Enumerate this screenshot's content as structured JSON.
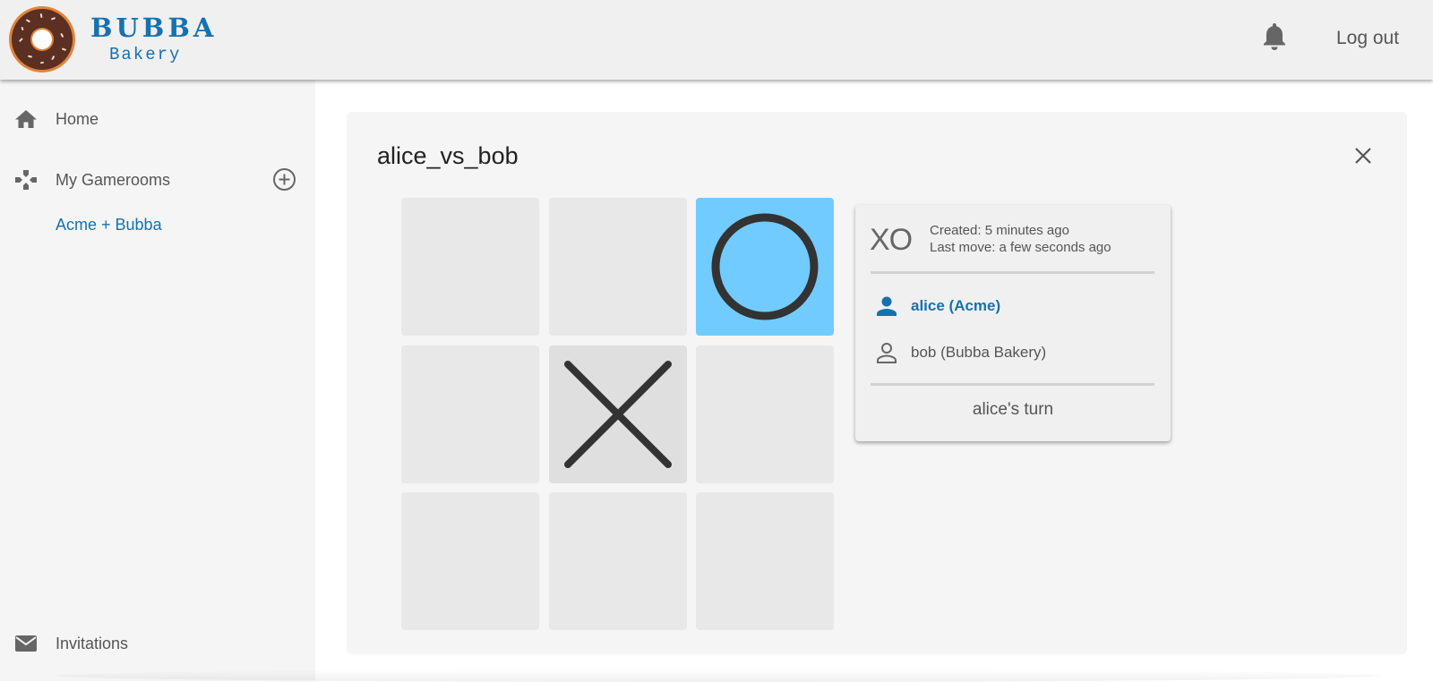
{
  "header": {
    "brand_title": "BUBBA",
    "brand_subtitle": "Bakery",
    "logout_label": "Log out"
  },
  "sidebar": {
    "items": [
      {
        "label": "Home",
        "icon": "home-icon"
      },
      {
        "label": "My Gamerooms",
        "icon": "gamepad-icon"
      },
      {
        "label": "Invitations",
        "icon": "mail-icon"
      }
    ],
    "gamerooms": [
      "Acme + Bubba"
    ]
  },
  "game": {
    "title": "alice_vs_bob",
    "board": [
      "",
      "",
      "O",
      "",
      "X",
      "",
      "",
      "",
      ""
    ],
    "info": {
      "mark_label": "XO",
      "created": "Created: 5 minutes ago",
      "last_move": "Last move: a few seconds ago",
      "players": [
        {
          "name": "alice (Acme)",
          "active": true
        },
        {
          "name": "bob (Bubba Bakery)",
          "active": false
        }
      ],
      "turn_text": "alice's turn"
    }
  },
  "colors": {
    "brand": "#1472b0",
    "o_cell": "#72cbff",
    "mark": "#333333"
  }
}
